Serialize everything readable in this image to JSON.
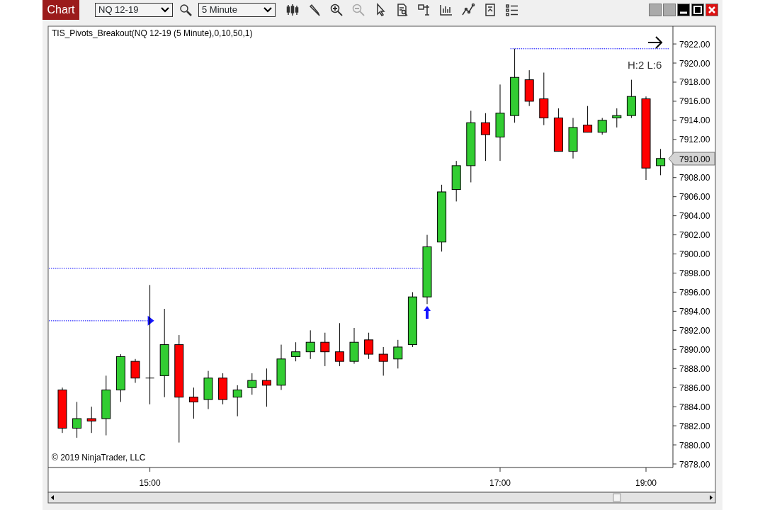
{
  "toolbar": {
    "chart_button": "Chart",
    "instrument": "NQ 12-19",
    "interval": "5 Minute"
  },
  "chart": {
    "title": "TIS_Pivots_Breakout(NQ 12-19 (5 Minute),0,10,50,1)",
    "signal_label": "H:2 L:6",
    "copyright": "© 2019 NinjaTrader, LLC",
    "current_price": "7910.00",
    "chart_data": {
      "type": "candlestick",
      "categories": [
        null,
        null,
        null,
        null,
        null,
        null,
        "15:00",
        null,
        null,
        null,
        null,
        null,
        null,
        null,
        null,
        null,
        null,
        null,
        null,
        null,
        null,
        null,
        null,
        null,
        null,
        null,
        null,
        null,
        null,
        null,
        "17:00",
        null,
        null,
        null,
        null,
        null,
        null,
        null,
        null,
        null,
        "19:00",
        null
      ],
      "ohlc": [
        [
          7885.75,
          7886,
          7881.25,
          7881.75
        ],
        [
          7881.75,
          7884.5,
          7880.75,
          7882.75
        ],
        [
          7882.75,
          7884,
          7881.25,
          7882.5
        ],
        [
          7882.75,
          7887.25,
          7881,
          7885.75
        ],
        [
          7885.75,
          7889.5,
          7884.5,
          7889.25
        ],
        [
          7888.75,
          7889,
          7886.5,
          7887
        ],
        [
          7887,
          7896.75,
          7884.25,
          7887
        ],
        [
          7887.25,
          7894.25,
          7885,
          7890.5
        ],
        [
          7890.5,
          7891.5,
          7880.25,
          7885
        ],
        [
          7885,
          7886,
          7882.75,
          7884.5
        ],
        [
          7884.75,
          7887.75,
          7883.75,
          7887
        ],
        [
          7887,
          7887.5,
          7884.25,
          7884.75
        ],
        [
          7885,
          7886.25,
          7883,
          7885.75
        ],
        [
          7886,
          7887.5,
          7885.25,
          7886.75
        ],
        [
          7886.75,
          7888,
          7884,
          7886.25
        ],
        [
          7886.25,
          7890.5,
          7885.75,
          7889
        ],
        [
          7889.25,
          7890.75,
          7888.75,
          7889.75
        ],
        [
          7889.75,
          7892,
          7889,
          7890.75
        ],
        [
          7890.75,
          7891.75,
          7888.25,
          7889.75
        ],
        [
          7889.75,
          7892.75,
          7888.25,
          7888.75
        ],
        [
          7888.75,
          7892.25,
          7888.5,
          7890.75
        ],
        [
          7891,
          7891.75,
          7889,
          7889.5
        ],
        [
          7889.5,
          7890.25,
          7887.25,
          7888.75
        ],
        [
          7889,
          7891,
          7888,
          7890.25
        ],
        [
          7890.5,
          7896,
          7890.25,
          7895.5
        ],
        [
          7895.5,
          7902,
          7894.75,
          7900.75
        ],
        [
          7901.25,
          7907.25,
          7900.25,
          7906.5
        ],
        [
          7906.75,
          7909.75,
          7905.5,
          7909.25
        ],
        [
          7909.25,
          7915,
          7907.5,
          7913.75
        ],
        [
          7913.75,
          7914.75,
          7909.75,
          7912.5
        ],
        [
          7912.25,
          7917.75,
          7909.75,
          7914.75
        ],
        [
          7914.5,
          7921.5,
          7913.75,
          7918.5
        ],
        [
          7918.25,
          7919.25,
          7915.5,
          7916
        ],
        [
          7916.25,
          7919,
          7913.5,
          7914.25
        ],
        [
          7914.25,
          7915.25,
          7910.75,
          7910.75
        ],
        [
          7910.75,
          7914.25,
          7910,
          7913.25
        ],
        [
          7913.5,
          7915.5,
          7912.75,
          7912.75
        ],
        [
          7912.75,
          7914.25,
          7912.5,
          7914
        ],
        [
          7914.25,
          7915.25,
          7913.25,
          7914.5
        ],
        [
          7914.5,
          7918.25,
          7914.25,
          7916.5
        ],
        [
          7916.25,
          7916.5,
          7907.75,
          7909
        ],
        [
          7909.25,
          7911,
          7908.25,
          7910
        ]
      ],
      "ylim": [
        7877.63,
        7923.86
      ],
      "ref_lines": [
        {
          "axis": "y",
          "value": 7893
        },
        {
          "axis": "y",
          "value": 7898.5
        },
        {
          "axis": "y",
          "value": 7921.5
        }
      ],
      "yticks": [
        {
          "value": 7922,
          "label": "7922.00"
        },
        {
          "value": 7920,
          "label": "7920.00"
        },
        {
          "value": 7918,
          "label": "7918.00"
        },
        {
          "value": 7916,
          "label": "7916.00"
        },
        {
          "value": 7914,
          "label": "7914.00"
        },
        {
          "value": 7912,
          "label": "7912.00"
        },
        {
          "value": 7908,
          "label": "7908.00"
        },
        {
          "value": 7906,
          "label": "7906.00"
        },
        {
          "value": 7904,
          "label": "7904.00"
        },
        {
          "value": 7902,
          "label": "7902.00"
        },
        {
          "value": 7900,
          "label": "7900.00"
        },
        {
          "value": 7898,
          "label": "7898.00"
        },
        {
          "value": 7896,
          "label": "7896.00"
        },
        {
          "value": 7894,
          "label": "7894.00"
        },
        {
          "value": 7892,
          "label": "7892.00"
        },
        {
          "value": 7890,
          "label": "7890.00"
        },
        {
          "value": 7888,
          "label": "7888.00"
        },
        {
          "value": 7886,
          "label": "7886.00"
        },
        {
          "value": 7884,
          "label": "7884.00"
        },
        {
          "value": 7882,
          "label": "7882.00"
        },
        {
          "value": 7880,
          "label": "7880.00"
        },
        {
          "value": 7878,
          "label": "7878.00"
        }
      ]
    }
  }
}
